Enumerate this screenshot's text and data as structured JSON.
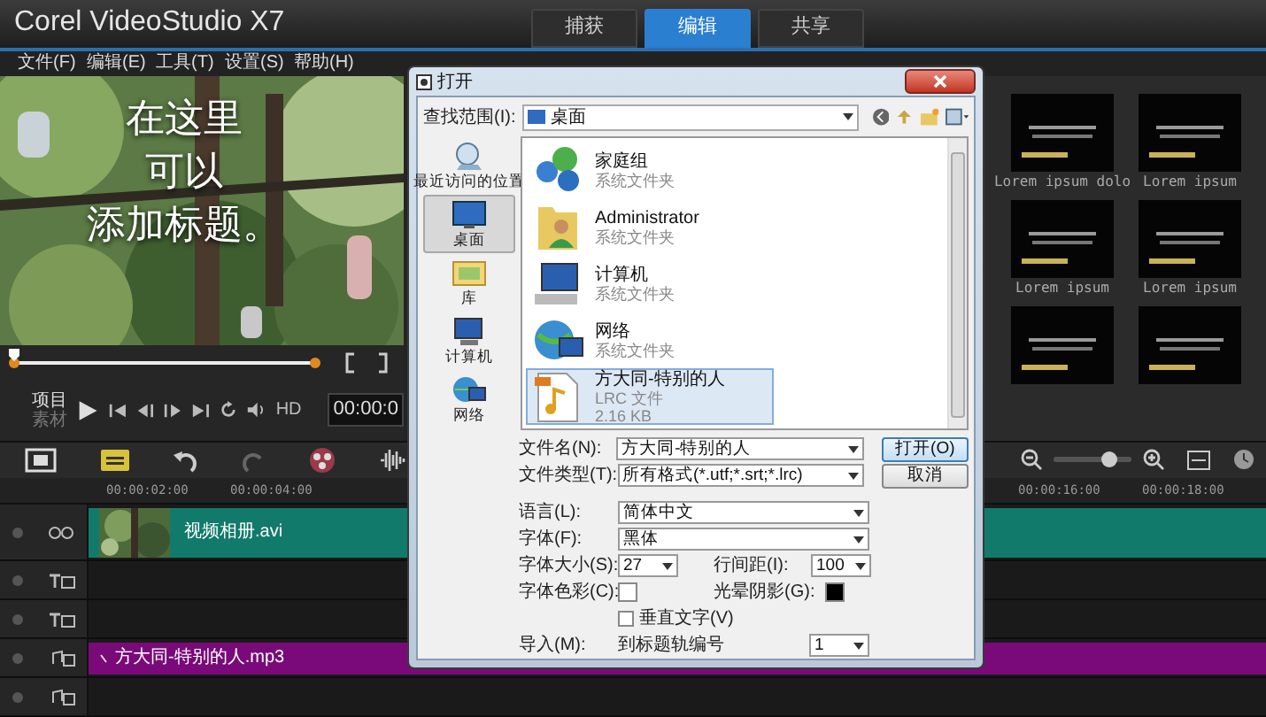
{
  "app": {
    "title": "Corel VideoStudio X7"
  },
  "tabs": [
    {
      "label": "捕获",
      "selected": false
    },
    {
      "label": "编辑",
      "selected": true
    },
    {
      "label": "共享",
      "selected": false
    }
  ],
  "menu": [
    "文件(F)",
    "编辑(E)",
    "工具(T)",
    "设置(S)",
    "帮助(H)"
  ],
  "preview": {
    "title_lines": [
      "在这里",
      "可以",
      "添加标题。"
    ]
  },
  "player": {
    "modes": [
      {
        "label": "项目",
        "selected": true
      },
      {
        "label": "素材",
        "selected": false
      }
    ],
    "hd": "HD",
    "timecode": "00:00:0"
  },
  "library": {
    "items": [
      {
        "kind": "captioned",
        "caption": "Lorem ipsum dolo"
      },
      {
        "kind": "captioned",
        "caption": "Lorem ipsum"
      },
      {
        "kind": "captioned",
        "caption": "Lorem ipsum"
      },
      {
        "kind": "captioned",
        "caption": "Lorem ipsum"
      },
      {
        "kind": "uncaptioned"
      },
      {
        "kind": "uncaptioned"
      }
    ]
  },
  "timeline": {
    "zoom_slider": {
      "level": 0.7
    },
    "ruler": [
      "00:00:02:00",
      "00:00:04:00",
      "00:00:16:00",
      "00:00:18:00"
    ],
    "tracks": [
      {
        "kind": "video",
        "clip": "视频相册.avi"
      },
      {
        "kind": "title"
      },
      {
        "kind": "title"
      },
      {
        "kind": "music",
        "clip": "方大同-特别的人.mp3"
      },
      {
        "kind": "music"
      }
    ]
  },
  "dialog": {
    "title": "打开",
    "look_in_label": "查找范围(I):",
    "look_in": "桌面",
    "places": [
      {
        "label": "最近访问的位置",
        "kind": "recent",
        "selected": false
      },
      {
        "label": "桌面",
        "kind": "desktop",
        "selected": true
      },
      {
        "label": "库",
        "kind": "library",
        "selected": false
      },
      {
        "label": "计算机",
        "kind": "computer",
        "selected": false
      },
      {
        "label": "网络",
        "kind": "network",
        "selected": false
      }
    ],
    "files": [
      {
        "name": "家庭组",
        "details": [
          "系统文件夹"
        ],
        "kind": "homegroup",
        "selected": false
      },
      {
        "name": "Administrator",
        "details": [
          "系统文件夹"
        ],
        "kind": "user",
        "selected": false
      },
      {
        "name": "计算机",
        "details": [
          "系统文件夹"
        ],
        "kind": "computer",
        "selected": false
      },
      {
        "name": "网络",
        "details": [
          "系统文件夹"
        ],
        "kind": "network",
        "selected": false
      },
      {
        "name": "方大同-特别的人",
        "details": [
          "LRC 文件",
          "2.16 KB"
        ],
        "kind": "lrc",
        "selected": true
      }
    ],
    "file_name": {
      "label": "文件名(N):",
      "value": "方大同-特别的人"
    },
    "file_type": {
      "label": "文件类型(T):",
      "value": "所有格式(*.utf;*.srt;*.lrc)"
    },
    "buttons": [
      "打开(O)",
      "取消"
    ],
    "language": {
      "label": "语言(L):",
      "value": "简体中文"
    },
    "font": {
      "label": "字体(F):",
      "value": "黑体"
    },
    "font_size": {
      "label": "字体大小(S):",
      "value": "27"
    },
    "line_spacing": {
      "label": "行间距(I):",
      "value": "100"
    },
    "font_color": {
      "label": "字体色彩(C):",
      "color": "#ffffff"
    },
    "glow_shadow": {
      "label": "光晕阴影(G):",
      "color": "#000000"
    },
    "vertical_text": {
      "label": "垂直文字(V)",
      "checked": false
    },
    "import": {
      "label": "导入(M):",
      "text": "到标题轨编号",
      "value": "1"
    }
  }
}
